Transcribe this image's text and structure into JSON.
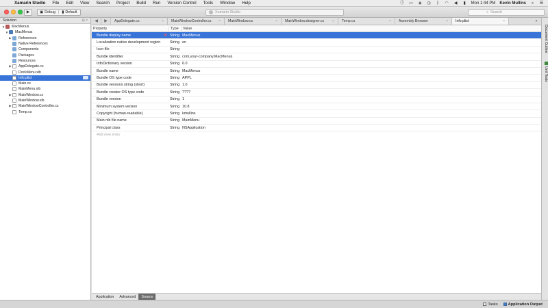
{
  "menubar": {
    "app_name": "Xamarin Studio",
    "items": [
      "File",
      "Edit",
      "View",
      "Search",
      "Project",
      "Build",
      "Run",
      "Version Control",
      "Tools",
      "Window",
      "Help"
    ],
    "clock": "Mon 1:44 PM",
    "user": "Kevin Mullins"
  },
  "toolbar": {
    "config": "Debug",
    "target": "Default",
    "status": "Xamarin Studio",
    "search_placeholder": "Search"
  },
  "solution": {
    "title": "Solution",
    "items": [
      {
        "label": "MacMenus",
        "indent": 0,
        "icon": "sol",
        "arrow": "▼"
      },
      {
        "label": "MacMenus",
        "indent": 1,
        "icon": "proj",
        "arrow": "▼"
      },
      {
        "label": "References",
        "indent": 2,
        "icon": "folder",
        "arrow": "▶"
      },
      {
        "label": "Native References",
        "indent": 2,
        "icon": "folder",
        "arrow": ""
      },
      {
        "label": "Components",
        "indent": 2,
        "icon": "folder",
        "arrow": ""
      },
      {
        "label": "Packages",
        "indent": 2,
        "icon": "folder",
        "arrow": ""
      },
      {
        "label": "Resources",
        "indent": 2,
        "icon": "folder",
        "arrow": ""
      },
      {
        "label": "AppDelegate.cs",
        "indent": 2,
        "icon": "file",
        "arrow": "▶"
      },
      {
        "label": "DockMenu.xib",
        "indent": 2,
        "icon": "file",
        "arrow": ""
      },
      {
        "label": "Info.plist",
        "indent": 2,
        "icon": "plist",
        "arrow": "",
        "selected": true
      },
      {
        "label": "Main.cs",
        "indent": 2,
        "icon": "file",
        "arrow": ""
      },
      {
        "label": "MainMenu.xib",
        "indent": 2,
        "icon": "file",
        "arrow": ""
      },
      {
        "label": "MainWindow.cs",
        "indent": 2,
        "icon": "file",
        "arrow": "▶"
      },
      {
        "label": "MainWindow.xib",
        "indent": 2,
        "icon": "file",
        "arrow": ""
      },
      {
        "label": "MainWindowController.cs",
        "indent": 2,
        "icon": "file",
        "arrow": "▶"
      },
      {
        "label": "Temp.cs",
        "indent": 2,
        "icon": "file",
        "arrow": ""
      }
    ]
  },
  "tabs": [
    {
      "label": "AppDelegate.cs",
      "active": false
    },
    {
      "label": "MainWindowController.cs",
      "active": false
    },
    {
      "label": "MainWindow.cs",
      "active": false
    },
    {
      "label": "MainWindow.designer.cs",
      "active": false
    },
    {
      "label": "Temp.cs",
      "active": false
    },
    {
      "label": "Assembly Browser",
      "active": false
    },
    {
      "label": "Info.plist",
      "active": true
    }
  ],
  "grid": {
    "headers": {
      "property": "Property",
      "type": "Type",
      "value": "Value"
    },
    "rows": [
      {
        "property": "Bundle display name",
        "type": "String",
        "value": "MacMenus",
        "selected": true
      },
      {
        "property": "Localization native development region",
        "type": "String",
        "value": "en"
      },
      {
        "property": "Icon file",
        "type": "String",
        "value": ""
      },
      {
        "property": "Bundle identifier",
        "type": "String",
        "value": "com.your-company.MacMenus"
      },
      {
        "property": "InfoDictionary version",
        "type": "String",
        "value": "6.0"
      },
      {
        "property": "Bundle name",
        "type": "String",
        "value": "MacMenus"
      },
      {
        "property": "Bundle OS type code",
        "type": "String",
        "value": "APPL"
      },
      {
        "property": "Bundle versions string (short)",
        "type": "String",
        "value": "1.0"
      },
      {
        "property": "Bundle creator OS type code",
        "type": "String",
        "value": "????"
      },
      {
        "property": "Bundle version",
        "type": "String",
        "value": "1"
      },
      {
        "property": "Minimum system version",
        "type": "String",
        "value": "10.8"
      },
      {
        "property": "Copyright (human-readable)",
        "type": "String",
        "value": "kmullins"
      },
      {
        "property": "Main nib file name",
        "type": "String",
        "value": "MainMenu"
      },
      {
        "property": "Principal class",
        "type": "String",
        "value": "NSApplication"
      }
    ],
    "add_entry": "Add new entry"
  },
  "bottom_tabs": [
    {
      "label": "Application",
      "active": false
    },
    {
      "label": "Advanced",
      "active": false
    },
    {
      "label": "Source",
      "active": true
    }
  ],
  "right_pad": {
    "outline": "Document Outline",
    "unit_tests": "Unit Tests"
  },
  "statusbar": {
    "tasks": "Tasks",
    "output": "Application Output"
  },
  "colors": {
    "selection": "#3874d8",
    "remove": "#e33333",
    "active_bottom_tab": "#6b6b6b"
  }
}
